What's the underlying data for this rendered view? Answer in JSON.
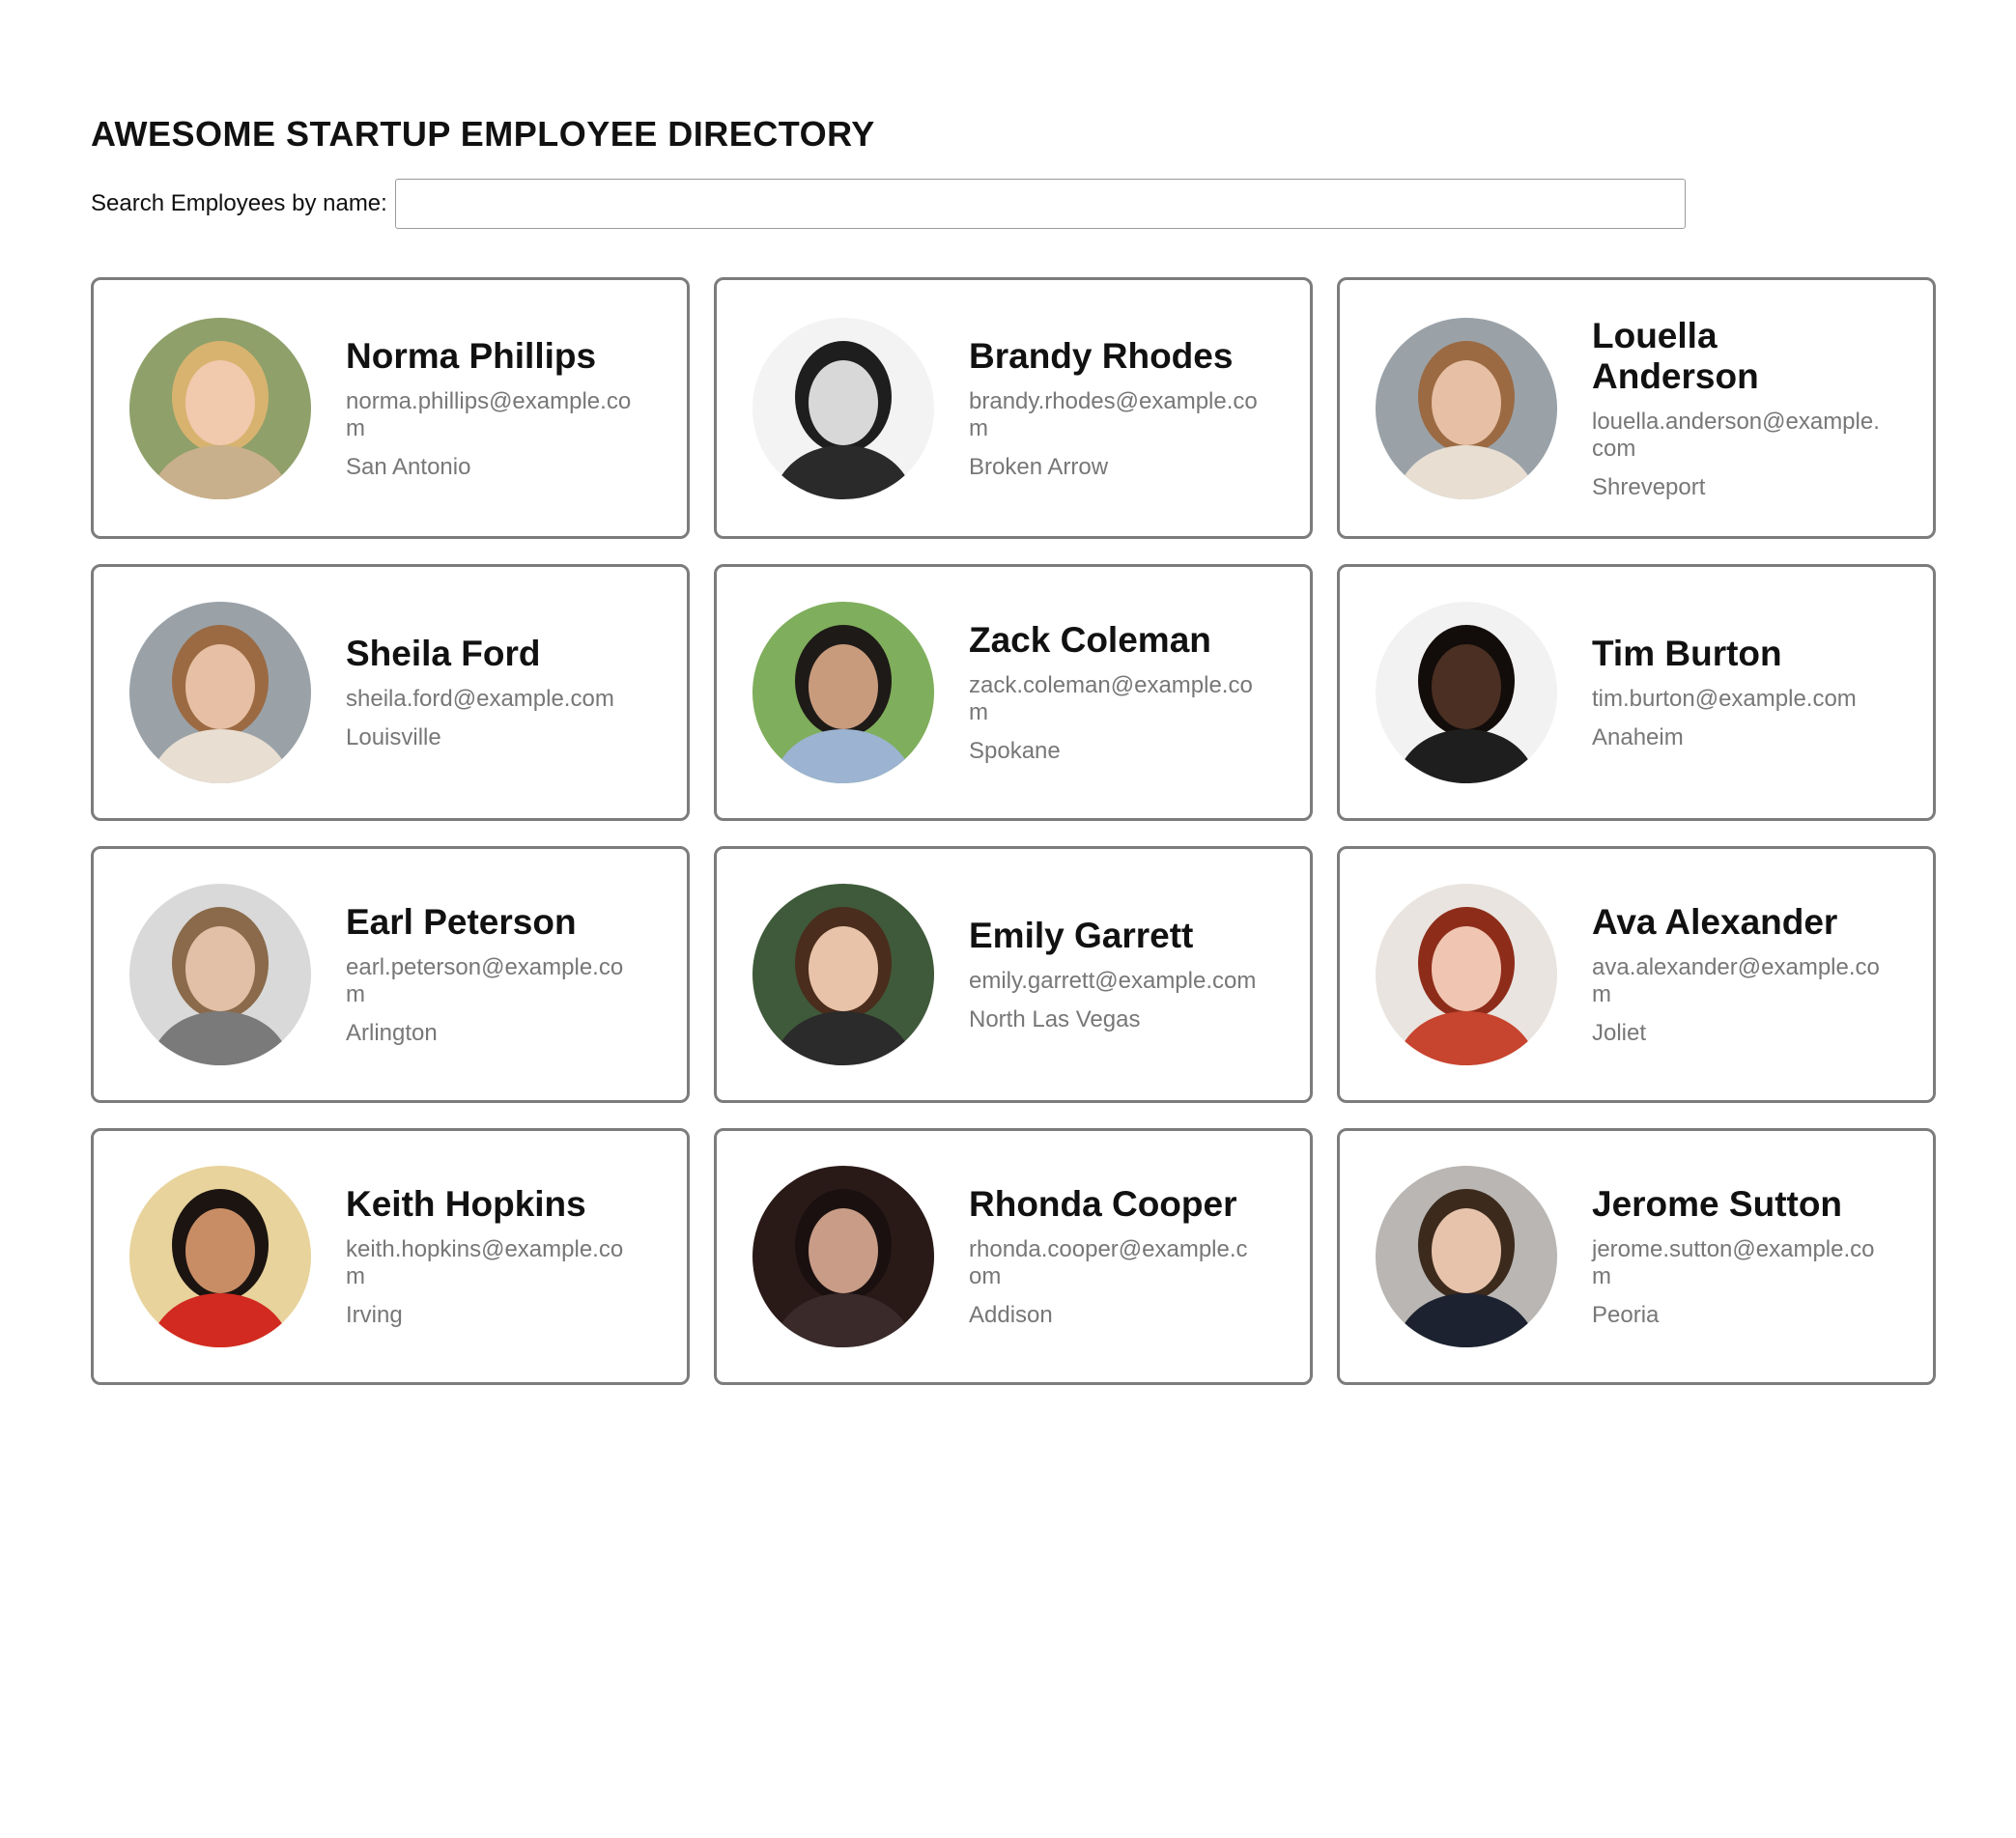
{
  "header": {
    "title": "AWESOME STARTUP EMPLOYEE DIRECTORY"
  },
  "search": {
    "label": "Search Employees by name:",
    "value": "",
    "placeholder": ""
  },
  "employees": [
    {
      "name": "Norma Phillips",
      "email": "norma.phillips@example.com",
      "city": "San Antonio",
      "bg": "#8fa06a",
      "skin": "#f1c9ad",
      "hair": "#d8b36f",
      "shirt": "#c9b08c"
    },
    {
      "name": "Brandy Rhodes",
      "email": "brandy.rhodes@example.com",
      "city": "Broken Arrow",
      "bg": "#f3f3f3",
      "skin": "#d8d8d8",
      "hair": "#1e1e1e",
      "shirt": "#2a2a2a"
    },
    {
      "name": "Louella Anderson",
      "email": "louella.anderson@example.com",
      "city": "Shreveport",
      "bg": "#9aa2a8",
      "skin": "#e7bfa4",
      "hair": "#9b6a43",
      "shirt": "#e8ded2"
    },
    {
      "name": "Sheila Ford",
      "email": "sheila.ford@example.com",
      "city": "Louisville",
      "bg": "#9aa2a8",
      "skin": "#e7bfa4",
      "hair": "#9b6a43",
      "shirt": "#e8ded2"
    },
    {
      "name": "Zack Coleman",
      "email": "zack.coleman@example.com",
      "city": "Spokane",
      "bg": "#7fae5c",
      "skin": "#c99b7d",
      "hair": "#1e1a17",
      "shirt": "#9cb3d1"
    },
    {
      "name": "Tim Burton",
      "email": "tim.burton@example.com",
      "city": "Anaheim",
      "bg": "#f2f2f2",
      "skin": "#4a2f22",
      "hair": "#120c0a",
      "shirt": "#1e1e1e"
    },
    {
      "name": "Earl Peterson",
      "email": "earl.peterson@example.com",
      "city": "Arlington",
      "bg": "#d9d9d9",
      "skin": "#e2c0a7",
      "hair": "#8a6a4a",
      "shirt": "#7a7a7a"
    },
    {
      "name": "Emily Garrett",
      "email": "emily.garrett@example.com",
      "city": "North Las Vegas",
      "bg": "#3f5a3a",
      "skin": "#e9c3a9",
      "hair": "#4a2d1c",
      "shirt": "#2b2b2b"
    },
    {
      "name": "Ava Alexander",
      "email": "ava.alexander@example.com",
      "city": "Joliet",
      "bg": "#e9e4df",
      "skin": "#f0c5b1",
      "hair": "#8e2c1a",
      "shirt": "#c7442e"
    },
    {
      "name": "Keith Hopkins",
      "email": "keith.hopkins@example.com",
      "city": "Irving",
      "bg": "#e8d39c",
      "skin": "#c98d65",
      "hair": "#1c1410",
      "shirt": "#d22a20"
    },
    {
      "name": "Rhonda Cooper",
      "email": "rhonda.cooper@example.com",
      "city": "Addison",
      "bg": "#2a1a17",
      "skin": "#c89c86",
      "hair": "#1a1010",
      "shirt": "#3a2a2a"
    },
    {
      "name": "Jerome Sutton",
      "email": "jerome.sutton@example.com",
      "city": "Peoria",
      "bg": "#b9b6b3",
      "skin": "#e6c3aa",
      "hair": "#3c2a1d",
      "shirt": "#1c2230"
    }
  ]
}
